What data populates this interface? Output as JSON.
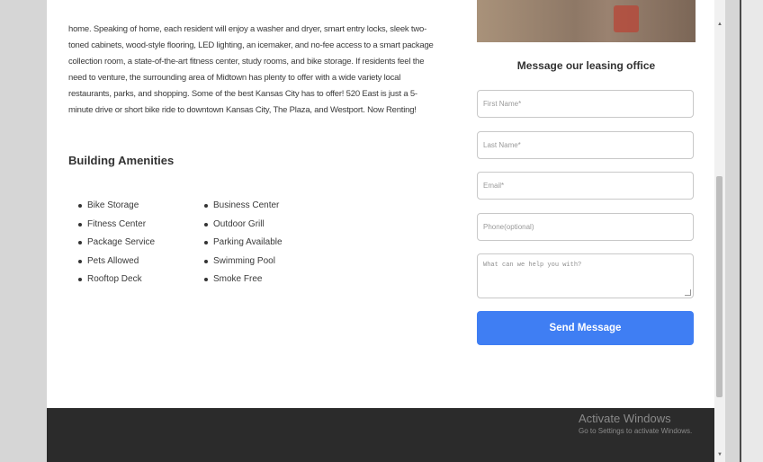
{
  "description_text": "home. Speaking of home, each resident will enjoy a washer and dryer, smart entry locks, sleek two-toned cabinets, wood-style flooring, LED lighting, an icemaker, and no-fee access to a smart package collection room, a state-of-the-art fitness center, study rooms, and bike storage. If residents feel the need to venture, the surrounding area of Midtown has plenty to offer with a wide variety local restaurants, parks, and shopping. Some of the best Kansas City has to offer! 520 East is just a 5-minute drive or short bike ride to downtown Kansas City, The Plaza, and Westport. Now Renting!",
  "amenities": {
    "title": "Building Amenities",
    "column1": [
      "Bike Storage",
      "Fitness Center",
      "Package Service",
      "Pets Allowed",
      "Rooftop Deck"
    ],
    "column2": [
      "Business Center",
      "Outdoor Grill",
      "Parking Available",
      "Swimming Pool",
      "Smoke Free"
    ]
  },
  "contact_form": {
    "title": "Message our leasing office",
    "first_name_placeholder": "First Name*",
    "last_name_placeholder": "Last Name*",
    "email_placeholder": "Email*",
    "phone_placeholder": "Phone(optional)",
    "message_placeholder": "What can we help you with?",
    "send_label": "Send Message"
  },
  "watermark": {
    "title": "Activate Windows",
    "subtitle": "Go to Settings to activate Windows."
  },
  "colors": {
    "accent": "#3f7ef3",
    "footer": "#2b2b2b"
  }
}
